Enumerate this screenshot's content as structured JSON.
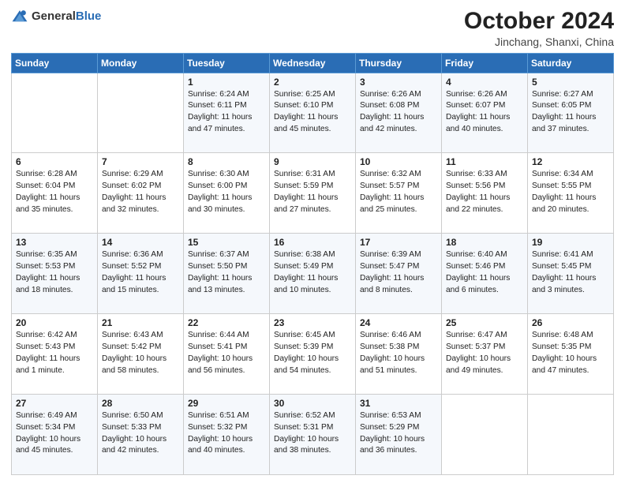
{
  "header": {
    "logo_general": "General",
    "logo_blue": "Blue",
    "month": "October 2024",
    "location": "Jinchang, Shanxi, China"
  },
  "weekdays": [
    "Sunday",
    "Monday",
    "Tuesday",
    "Wednesday",
    "Thursday",
    "Friday",
    "Saturday"
  ],
  "weeks": [
    [
      {
        "day": "",
        "info": ""
      },
      {
        "day": "",
        "info": ""
      },
      {
        "day": "1",
        "info": "Sunrise: 6:24 AM\nSunset: 6:11 PM\nDaylight: 11 hours and 47 minutes."
      },
      {
        "day": "2",
        "info": "Sunrise: 6:25 AM\nSunset: 6:10 PM\nDaylight: 11 hours and 45 minutes."
      },
      {
        "day": "3",
        "info": "Sunrise: 6:26 AM\nSunset: 6:08 PM\nDaylight: 11 hours and 42 minutes."
      },
      {
        "day": "4",
        "info": "Sunrise: 6:26 AM\nSunset: 6:07 PM\nDaylight: 11 hours and 40 minutes."
      },
      {
        "day": "5",
        "info": "Sunrise: 6:27 AM\nSunset: 6:05 PM\nDaylight: 11 hours and 37 minutes."
      }
    ],
    [
      {
        "day": "6",
        "info": "Sunrise: 6:28 AM\nSunset: 6:04 PM\nDaylight: 11 hours and 35 minutes."
      },
      {
        "day": "7",
        "info": "Sunrise: 6:29 AM\nSunset: 6:02 PM\nDaylight: 11 hours and 32 minutes."
      },
      {
        "day": "8",
        "info": "Sunrise: 6:30 AM\nSunset: 6:00 PM\nDaylight: 11 hours and 30 minutes."
      },
      {
        "day": "9",
        "info": "Sunrise: 6:31 AM\nSunset: 5:59 PM\nDaylight: 11 hours and 27 minutes."
      },
      {
        "day": "10",
        "info": "Sunrise: 6:32 AM\nSunset: 5:57 PM\nDaylight: 11 hours and 25 minutes."
      },
      {
        "day": "11",
        "info": "Sunrise: 6:33 AM\nSunset: 5:56 PM\nDaylight: 11 hours and 22 minutes."
      },
      {
        "day": "12",
        "info": "Sunrise: 6:34 AM\nSunset: 5:55 PM\nDaylight: 11 hours and 20 minutes."
      }
    ],
    [
      {
        "day": "13",
        "info": "Sunrise: 6:35 AM\nSunset: 5:53 PM\nDaylight: 11 hours and 18 minutes."
      },
      {
        "day": "14",
        "info": "Sunrise: 6:36 AM\nSunset: 5:52 PM\nDaylight: 11 hours and 15 minutes."
      },
      {
        "day": "15",
        "info": "Sunrise: 6:37 AM\nSunset: 5:50 PM\nDaylight: 11 hours and 13 minutes."
      },
      {
        "day": "16",
        "info": "Sunrise: 6:38 AM\nSunset: 5:49 PM\nDaylight: 11 hours and 10 minutes."
      },
      {
        "day": "17",
        "info": "Sunrise: 6:39 AM\nSunset: 5:47 PM\nDaylight: 11 hours and 8 minutes."
      },
      {
        "day": "18",
        "info": "Sunrise: 6:40 AM\nSunset: 5:46 PM\nDaylight: 11 hours and 6 minutes."
      },
      {
        "day": "19",
        "info": "Sunrise: 6:41 AM\nSunset: 5:45 PM\nDaylight: 11 hours and 3 minutes."
      }
    ],
    [
      {
        "day": "20",
        "info": "Sunrise: 6:42 AM\nSunset: 5:43 PM\nDaylight: 11 hours and 1 minute."
      },
      {
        "day": "21",
        "info": "Sunrise: 6:43 AM\nSunset: 5:42 PM\nDaylight: 10 hours and 58 minutes."
      },
      {
        "day": "22",
        "info": "Sunrise: 6:44 AM\nSunset: 5:41 PM\nDaylight: 10 hours and 56 minutes."
      },
      {
        "day": "23",
        "info": "Sunrise: 6:45 AM\nSunset: 5:39 PM\nDaylight: 10 hours and 54 minutes."
      },
      {
        "day": "24",
        "info": "Sunrise: 6:46 AM\nSunset: 5:38 PM\nDaylight: 10 hours and 51 minutes."
      },
      {
        "day": "25",
        "info": "Sunrise: 6:47 AM\nSunset: 5:37 PM\nDaylight: 10 hours and 49 minutes."
      },
      {
        "day": "26",
        "info": "Sunrise: 6:48 AM\nSunset: 5:35 PM\nDaylight: 10 hours and 47 minutes."
      }
    ],
    [
      {
        "day": "27",
        "info": "Sunrise: 6:49 AM\nSunset: 5:34 PM\nDaylight: 10 hours and 45 minutes."
      },
      {
        "day": "28",
        "info": "Sunrise: 6:50 AM\nSunset: 5:33 PM\nDaylight: 10 hours and 42 minutes."
      },
      {
        "day": "29",
        "info": "Sunrise: 6:51 AM\nSunset: 5:32 PM\nDaylight: 10 hours and 40 minutes."
      },
      {
        "day": "30",
        "info": "Sunrise: 6:52 AM\nSunset: 5:31 PM\nDaylight: 10 hours and 38 minutes."
      },
      {
        "day": "31",
        "info": "Sunrise: 6:53 AM\nSunset: 5:29 PM\nDaylight: 10 hours and 36 minutes."
      },
      {
        "day": "",
        "info": ""
      },
      {
        "day": "",
        "info": ""
      }
    ]
  ]
}
